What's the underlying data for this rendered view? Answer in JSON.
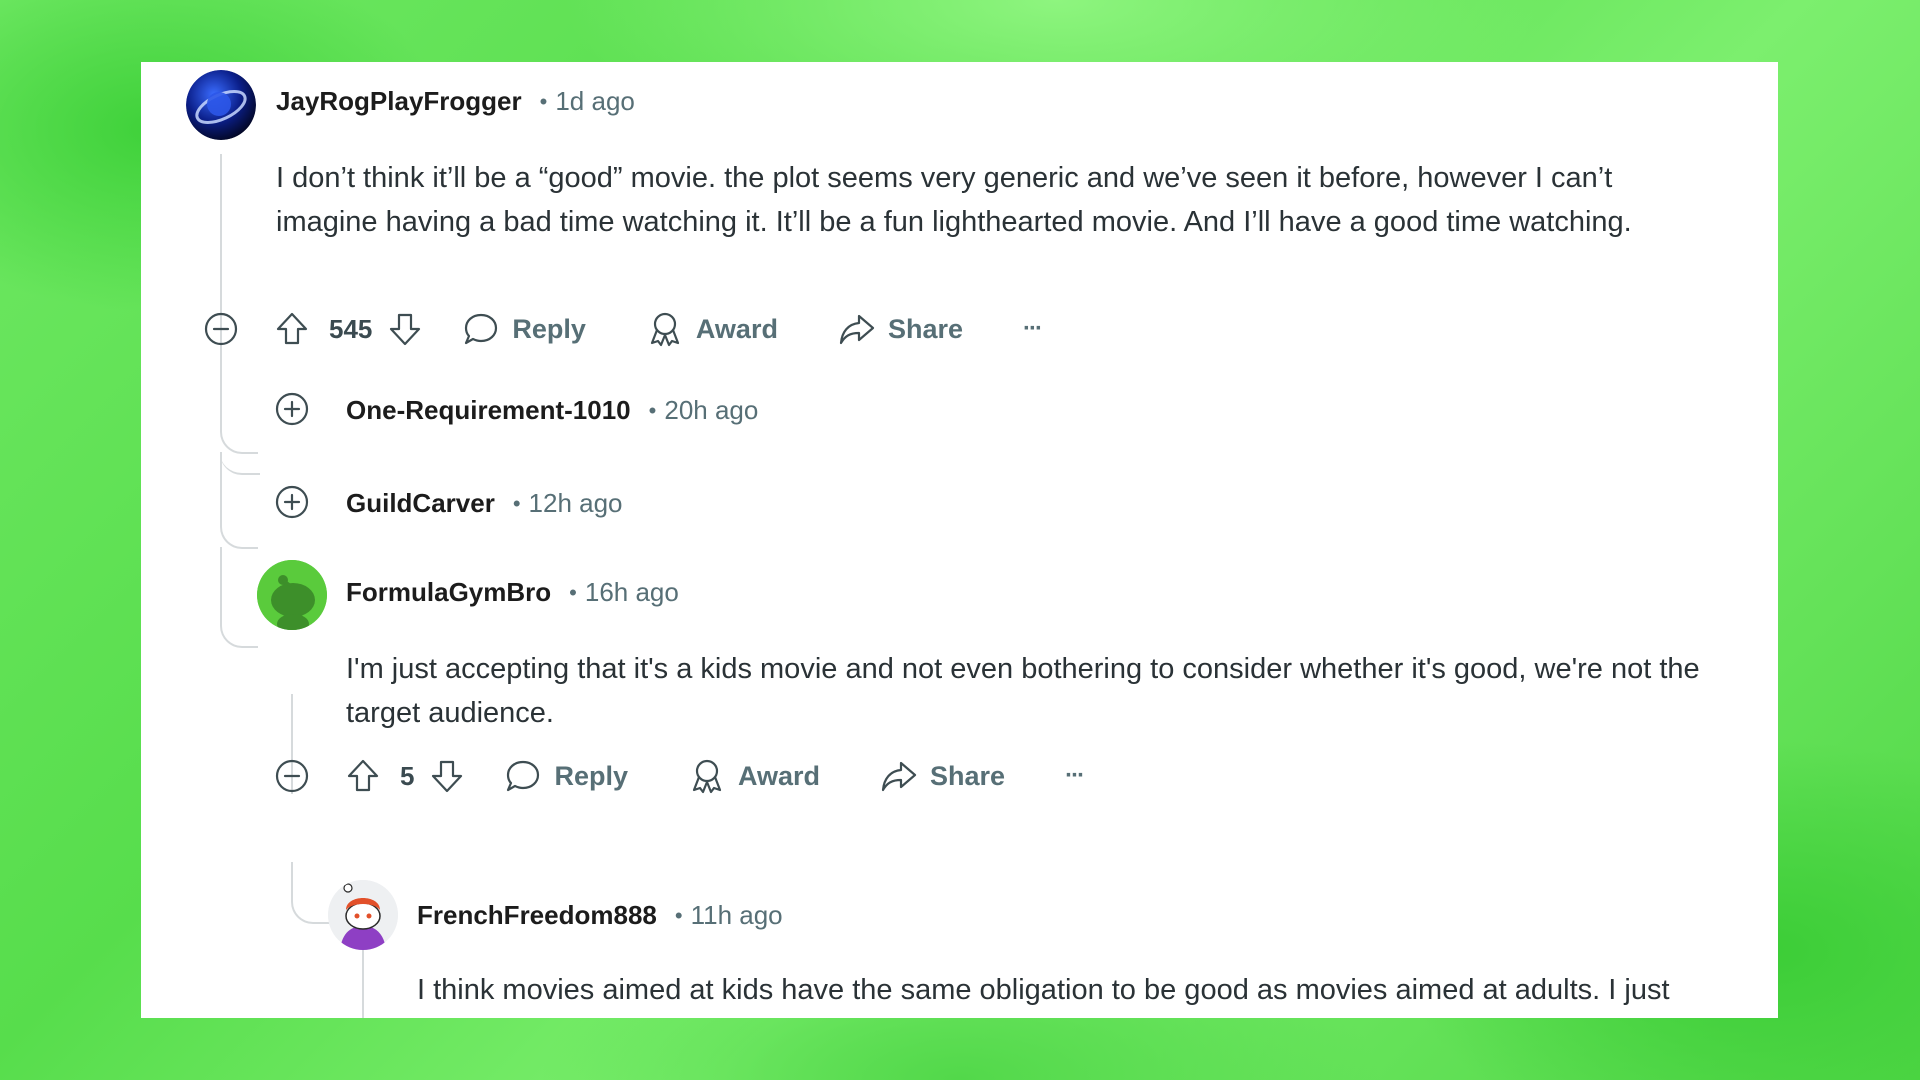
{
  "comments": {
    "c1": {
      "username": "JayRogPlayFrogger",
      "time": "1d ago",
      "text": "I don’t think it’ll be a “good” movie. the plot seems very generic and we’ve seen it before, however I can’t imagine having a bad time watching it. It’ll be a fun lighthearted movie. And I’ll have a good time watching.",
      "votes": "545"
    },
    "c2": {
      "username": "One-Requirement-1010",
      "time": "20h ago"
    },
    "c3": {
      "username": "GuildCarver",
      "time": "12h ago"
    },
    "c4": {
      "username": "FormulaGymBro",
      "time": "16h ago",
      "text": "I'm just accepting that it's a kids movie and not even bothering to consider whether it's good, we're not the target audience.",
      "votes": "5"
    },
    "c5": {
      "username": "FrenchFreedom888",
      "time": "11h ago",
      "text": "I think movies aimed at kids have the same obligation to be good as movies aimed at adults. I just think this movie will suck and be painful to watch, for either kids or adults"
    }
  },
  "labels": {
    "separator": "•",
    "reply": "Reply",
    "award": "Award",
    "share": "Share",
    "more": "···"
  },
  "icons": {
    "collapse": "minus-circle-icon",
    "expand": "plus-circle-icon",
    "upvote": "arrow-up-icon",
    "downvote": "arrow-down-icon",
    "reply": "speech-bubble-icon",
    "award": "award-ribbon-icon",
    "share": "share-arrow-icon"
  },
  "colors": {
    "background": "#5fe055",
    "card": "#ffffff",
    "meta": "#576f76",
    "thread_line": "#d6dadc"
  }
}
